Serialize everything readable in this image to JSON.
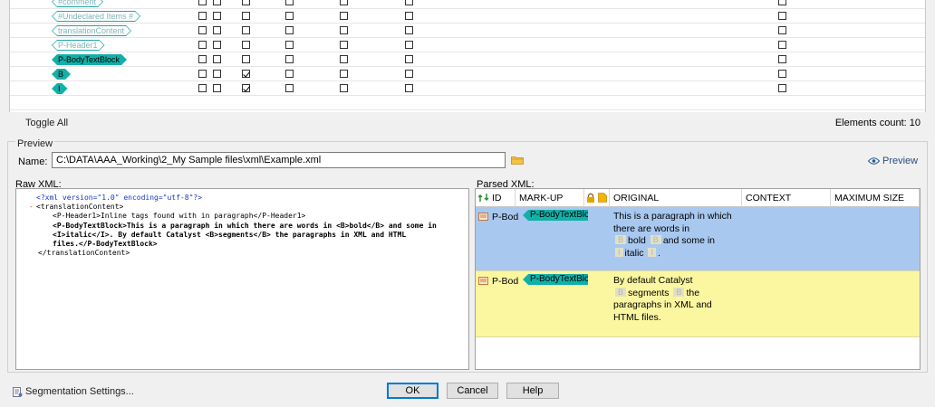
{
  "elements": {
    "rows": [
      {
        "label": "#comment",
        "style": "outline",
        "checks": [
          false,
          false,
          false,
          false,
          false,
          false,
          false,
          false
        ]
      },
      {
        "label": "#Undeclared Items #",
        "style": "outline",
        "checks": [
          false,
          false,
          false,
          false,
          false,
          false,
          false,
          false
        ]
      },
      {
        "label": "translationContent",
        "style": "outline",
        "checks": [
          false,
          false,
          false,
          false,
          false,
          false,
          false,
          false
        ]
      },
      {
        "label": "P-Header1",
        "style": "outline",
        "checks": [
          false,
          false,
          false,
          false,
          false,
          false,
          false,
          false
        ]
      },
      {
        "label": "P-BodyTextBlock",
        "style": "filled",
        "checks": [
          false,
          false,
          false,
          false,
          false,
          false,
          false,
          false
        ]
      },
      {
        "label": "B",
        "style": "filled",
        "checks": [
          false,
          false,
          true,
          false,
          false,
          false,
          false,
          false
        ]
      },
      {
        "label": "I",
        "style": "filled",
        "checks": [
          false,
          false,
          true,
          false,
          false,
          false,
          false,
          false
        ]
      }
    ],
    "toggle_all": "Toggle All",
    "count_text": "Elements count: 10"
  },
  "preview": {
    "caption": "Preview",
    "name_label": "Name:",
    "name_value": "C:\\DATA\\AAA_Working\\2_My Sample files\\xml\\Example.xml",
    "preview_link": "Preview",
    "raw_label": "Raw XML:",
    "parsed_label": "Parsed XML:"
  },
  "raw_xml": [
    "<?xml version=\"1.0\" encoding=\"utf-8\"?>",
    "<translationContent>",
    "<P-Header1>Inline tags found with in paragraph</P-Header1>",
    "<P-BodyTextBlock>This is a paragraph in which there are words in <B>bold</B> and some in",
    "<I>italic</I>. By default Catalyst <B>segments</B> the paragraphs in XML and HTML",
    "files.</P-BodyTextBlock>",
    "</translationContent>"
  ],
  "raw_minus": "-",
  "parsed": {
    "headers": {
      "id": "ID",
      "markup": "MARK-UP",
      "original": "ORIGINAL",
      "context": "CONTEXT",
      "max": "MAXIMUM SIZE"
    },
    "rows": [
      {
        "id": "P-Bod",
        "markup": "P-BodyTextBlock",
        "bg": "#a8c8f0",
        "lines": [
          [
            {
              "t": "This is a paragraph in which"
            }
          ],
          [
            {
              "t": "there are words in"
            }
          ],
          [
            {
              "tag": "B"
            },
            {
              "t": "bold"
            },
            {
              "tag": "B"
            },
            {
              "t": "and some in"
            }
          ],
          [
            {
              "tag": "I"
            },
            {
              "t": "italic"
            },
            {
              "tag": "I"
            },
            {
              "t": "."
            }
          ]
        ]
      },
      {
        "id": "P-Bod",
        "markup": "P-BodyTextBlock",
        "bg": "#fbf7a0",
        "lines": [
          [
            {
              "t": "By default Catalyst"
            }
          ],
          [
            {
              "tag": "B"
            },
            {
              "t": "segments"
            },
            {
              "tag": "B"
            },
            {
              "t": "the"
            }
          ],
          [
            {
              "t": "paragraphs in XML and"
            }
          ],
          [
            {
              "t": "HTML files."
            }
          ]
        ]
      }
    ]
  },
  "buttons": {
    "ok": "OK",
    "cancel": "Cancel",
    "help": "Help",
    "segmentation": "Segmentation Settings..."
  },
  "colors": {
    "tag_fill": "#11b0a8",
    "selected_row": "#a8c8f0",
    "highlight_row": "#fbf7a0",
    "pi_blue": "#1a36c4"
  }
}
